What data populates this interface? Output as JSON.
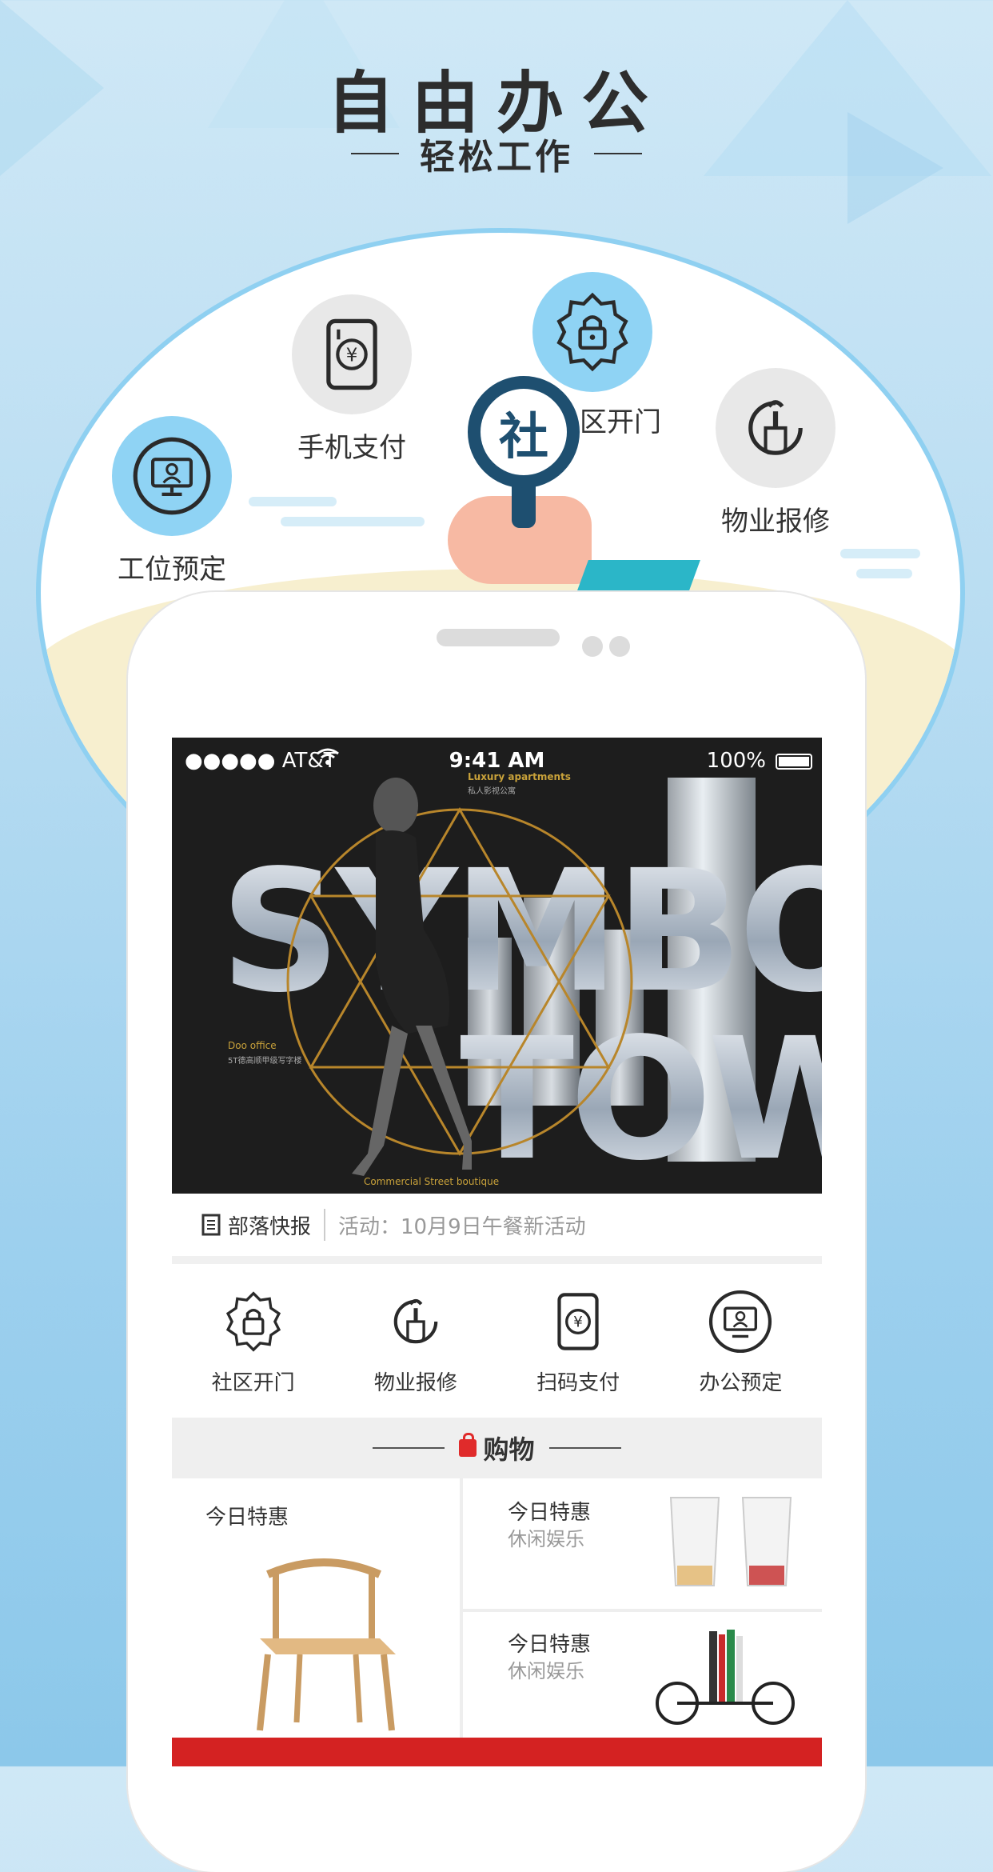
{
  "header": {
    "title": "自由办公",
    "subtitle": "轻松工作"
  },
  "features": [
    {
      "label": "工位预定",
      "icon": "monitor-person-icon"
    },
    {
      "label": "手机支付",
      "icon": "yen-card-icon"
    },
    {
      "label": "区开门",
      "icon": "lock-badge-icon"
    },
    {
      "label": "物业报修",
      "icon": "wrench-hand-icon"
    }
  ],
  "magnifier_char": "社",
  "phone": {
    "status_bar": {
      "carrier": "●●●●● AT&T",
      "time": "9:41 AM",
      "battery": "100%"
    },
    "banner": {
      "word1": "SYMBOL",
      "word2": "TOWER",
      "small_top": "Luxury apartments",
      "small_top_cn": "私人影视公寓",
      "small_left": "Doo office",
      "small_left_cn": "5T德高顺甲级写字楼",
      "small_bottom": "Commercial Street boutique"
    },
    "news": {
      "tag": "部落快报",
      "text": "活动：10月9日午餐新活动"
    },
    "quick_actions": [
      {
        "label": "社区开门",
        "icon": "lock-badge-icon"
      },
      {
        "label": "物业报修",
        "icon": "wrench-hand-icon"
      },
      {
        "label": "扫码支付",
        "icon": "yen-card-icon"
      },
      {
        "label": "办公预定",
        "icon": "monitor-person-icon"
      }
    ],
    "shop": {
      "heading": "购物",
      "big_card": {
        "title": "今日特惠",
        "image": "wooden-chair"
      },
      "cards": [
        {
          "title": "今日特惠",
          "subtitle": "休闲娱乐",
          "image": "glass-cups"
        },
        {
          "title": "今日特惠",
          "subtitle": "休闲娱乐",
          "image": "bike-bookends"
        }
      ]
    }
  },
  "colors": {
    "accent_blue": "#8fd3f4",
    "dark_blue": "#1e4f70",
    "red": "#d42222"
  }
}
